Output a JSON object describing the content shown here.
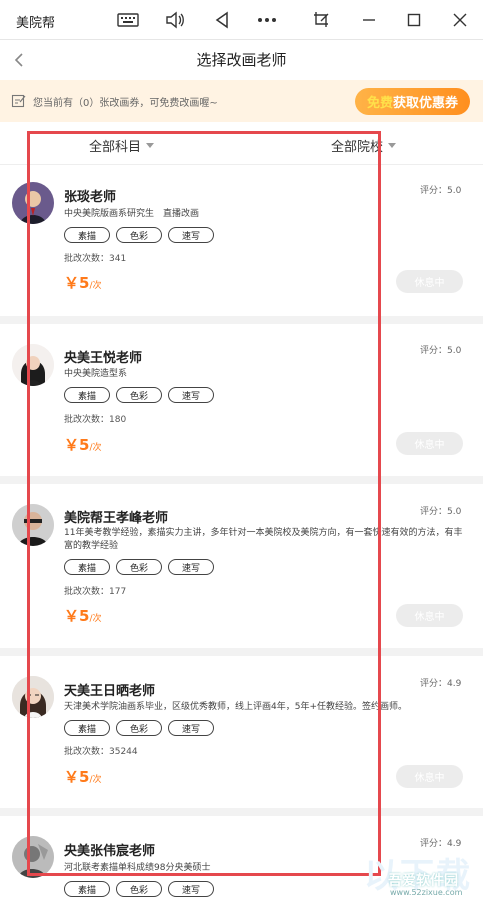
{
  "window": {
    "app_title": "美院帮"
  },
  "nav": {
    "title": "选择改画老师"
  },
  "coupon": {
    "text": "您当前有（0）张改画券，可免费改画喔~",
    "btn_free": "免费",
    "btn_rest": "获取优惠券"
  },
  "filters": {
    "subject": "全部科目",
    "school": "全部院校"
  },
  "teachers": [
    {
      "name": "张琰老师",
      "rating": "评分：5.0",
      "desc": "中央美院版画系研究生　直播改画",
      "tags": [
        "素描",
        "色彩",
        "速写"
      ],
      "count": "批改次数：341",
      "price_symbol": "￥",
      "price": "5",
      "price_unit": "/次",
      "status": "休息中"
    },
    {
      "name": "央美王悦老师",
      "rating": "评分：5.0",
      "desc": "中央美院造型系",
      "tags": [
        "素描",
        "色彩",
        "速写"
      ],
      "count": "批改次数：180",
      "price_symbol": "￥",
      "price": "5",
      "price_unit": "/次",
      "status": "休息中"
    },
    {
      "name": "美院帮王孝峰老师",
      "rating": "评分：5.0",
      "desc": "11年美考教学经验，素描实力主讲，多年针对一本美院校及美院方向，有一套快速有效的方法，有丰富的教学经验",
      "tags": [
        "素描",
        "色彩",
        "速写"
      ],
      "count": "批改次数：177",
      "price_symbol": "￥",
      "price": "5",
      "price_unit": "/次",
      "status": "休息中"
    },
    {
      "name": "天美王日晒老师",
      "rating": "评分：4.9",
      "desc": "天津美术学院油画系毕业，区级优秀教师，线上评画4年，5年+任教经验。签约画师。",
      "tags": [
        "素描",
        "色彩",
        "速写"
      ],
      "count": "批改次数：35244",
      "price_symbol": "￥",
      "price": "5",
      "price_unit": "/次",
      "status": "休息中"
    },
    {
      "name": "央美张伟宸老师",
      "rating": "评分：4.9",
      "desc": "河北联考素描单科成绩98分央美硕士",
      "tags": [
        "素描",
        "色彩",
        "速写"
      ]
    }
  ],
  "watermark": {
    "big": "以下载",
    "small": "吾爱软件园",
    "url": "www.52zixue.com"
  }
}
